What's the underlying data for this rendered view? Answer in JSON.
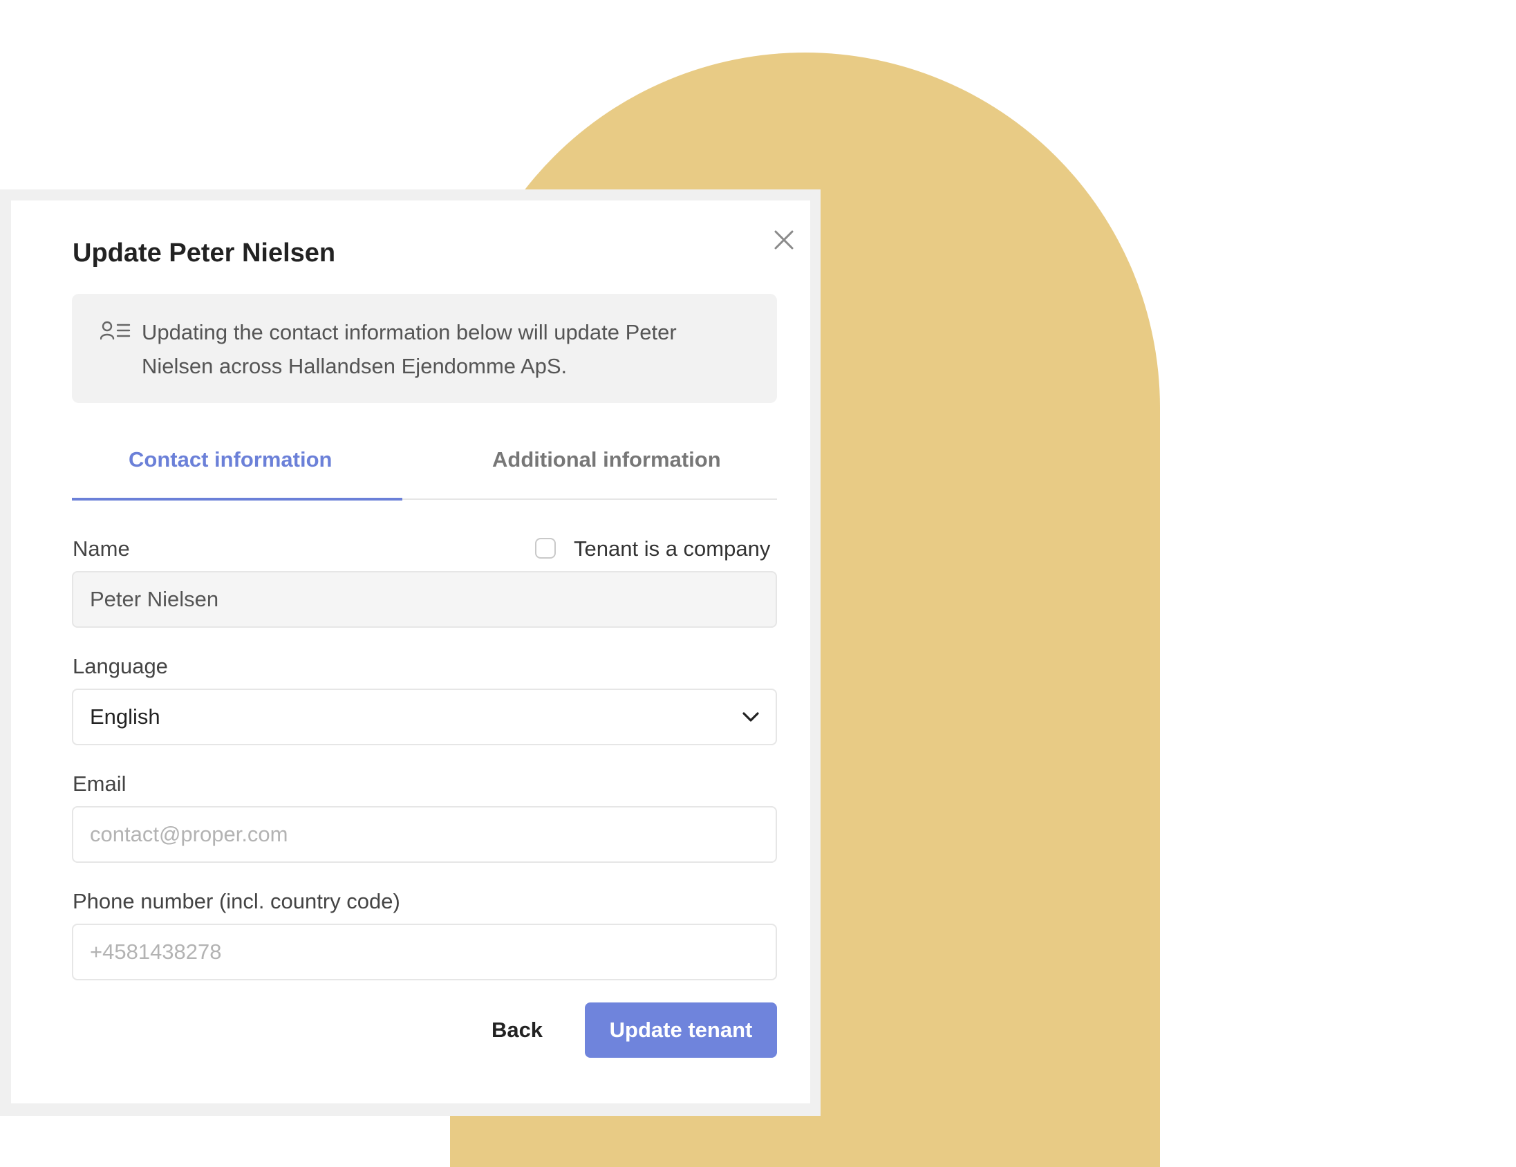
{
  "modal": {
    "title": "Update Peter Nielsen",
    "close_icon": "close-icon"
  },
  "notice": {
    "icon": "contact-list-icon",
    "text": "Updating the contact information below will update Peter Nielsen across Hallandsen Ejendomme ApS."
  },
  "tabs": [
    {
      "label": "Contact information",
      "active": true
    },
    {
      "label": "Additional information",
      "active": false
    }
  ],
  "form": {
    "name": {
      "label": "Name",
      "value": "Peter Nielsen"
    },
    "company_checkbox": {
      "label": "Tenant is a company",
      "checked": false
    },
    "language": {
      "label": "Language",
      "value": "English"
    },
    "email": {
      "label": "Email",
      "value": "",
      "placeholder": "contact@proper.com"
    },
    "phone": {
      "label": "Phone number (incl. country code)",
      "value": "",
      "placeholder": "+4581438278"
    }
  },
  "actions": {
    "back_label": "Back",
    "submit_label": "Update tenant"
  },
  "colors": {
    "accent": "#6b80d8",
    "button": "#6f84dc",
    "background_shape": "#e8cb85"
  }
}
